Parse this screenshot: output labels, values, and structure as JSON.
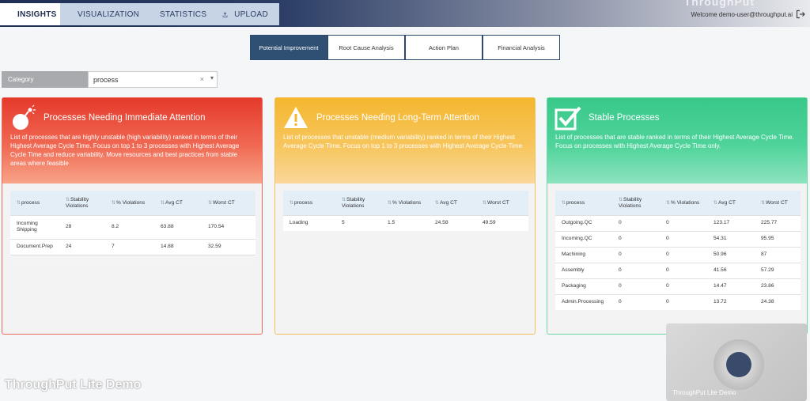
{
  "header": {
    "brand": "ThroughPut",
    "tabs": [
      {
        "label": "INSIGHTS",
        "icon": "insights-icon"
      },
      {
        "label": "VISUALIZATION",
        "icon": "chart-icon"
      },
      {
        "label": "STATISTICS",
        "icon": "table-icon"
      },
      {
        "label": "UPLOAD",
        "icon": "upload-icon"
      }
    ],
    "welcome": "Welcome demo-user@throughput.ai"
  },
  "subtabs": [
    "Potential Improvement",
    "Root Cause Analysis",
    "Action Plan",
    "Financial Analysis"
  ],
  "filter": {
    "label": "Category",
    "value": "process",
    "clear": "×",
    "caret": "▾"
  },
  "columns": [
    "process",
    "Stability Violations",
    "% Violations",
    "Avg CT",
    "Worst CT"
  ],
  "cards": {
    "immediate": {
      "title": "Processes Needing Immediate Attention",
      "desc": "List of processes that are highly unstable (high variability) ranked in terms of their Highest Average Cycle Time. Focus on top 1 to 3 processes with Highest Average Cycle Time and reduce variability. Move resources and best practices from stable areas where feasible",
      "rows": [
        [
          "Incoming Shipping",
          "28",
          "8.2",
          "63.88",
          "170.54"
        ],
        [
          "Document.Prep",
          "24",
          "7",
          "14.88",
          "32.59"
        ]
      ]
    },
    "longterm": {
      "title": "Processes Needing Long-Term Attention",
      "desc": "List of processes that unstable (medium variability) ranked in terms of their Highest Average Cycle Time. Focus on top 1 to 3 processes with Highest Average Cycle Time",
      "rows": [
        [
          "Loading",
          "5",
          "1.5",
          "24.58",
          "49.59"
        ]
      ]
    },
    "stable": {
      "title": "Stable Processes",
      "desc": "List of processes that are stable ranked in terms of their Highest Average Cycle Time. Focus on processes with Highest Average Cycle Time only.",
      "rows": [
        [
          "Outgoing.QC",
          "0",
          "0",
          "123.17",
          "225.77"
        ],
        [
          "Incoming.QC",
          "0",
          "0",
          "54.31",
          "95.95"
        ],
        [
          "Machining",
          "0",
          "0",
          "50.96",
          "87"
        ],
        [
          "Assembly",
          "0",
          "0",
          "41.56",
          "57.29"
        ],
        [
          "Packaging",
          "0",
          "0",
          "14.47",
          "23.86"
        ],
        [
          "Admin.Processing",
          "0",
          "0",
          "13.72",
          "24.38"
        ]
      ]
    }
  },
  "watermark": "ThroughPut Lite Demo",
  "video_caption": "ThroughPut Lite Demo"
}
